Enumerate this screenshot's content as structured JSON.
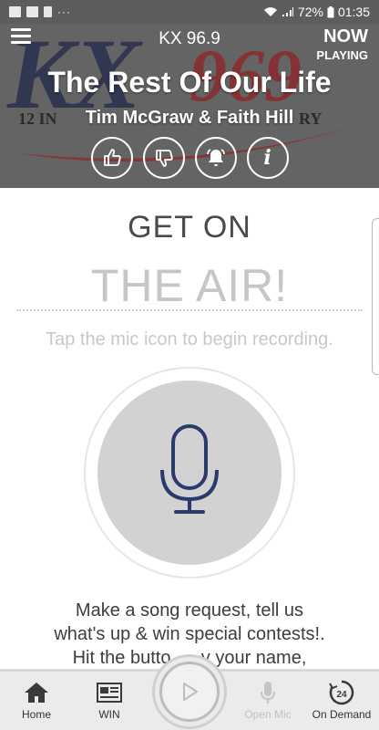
{
  "status_bar": {
    "battery": "72%",
    "time": "01:35",
    "dots": "···"
  },
  "header": {
    "station_name": "KX 96.9",
    "now_label": "NOW",
    "playing_label": "PLAYING",
    "song_title": "The Rest Of Our Life",
    "artist": "Tim McGraw & Faith Hill",
    "logo": {
      "big_text": "KX",
      "number_text": "969",
      "tagline_left": "12 IN",
      "tagline_right": "RY"
    },
    "action_info_label": "i"
  },
  "main": {
    "title_line1": "GET ON",
    "title_line2": "THE AIR!",
    "hint": "Tap the mic icon to begin recording.",
    "description_lines": [
      "Make a song request, tell us",
      "what's up & win special contests!.",
      "Hit the butto      y your name,"
    ]
  },
  "bottom_nav": {
    "items": [
      {
        "label": "Home",
        "icon": "home-icon",
        "enabled": true
      },
      {
        "label": "WIN",
        "icon": "newspaper-icon",
        "enabled": true
      },
      {
        "label": "Open Mic",
        "icon": "microphone-icon",
        "enabled": false
      },
      {
        "label": "On Demand",
        "icon": "on-demand-24-icon",
        "enabled": true
      }
    ],
    "on_demand_badge": "24"
  },
  "colors": {
    "header_bg": "#646464",
    "mic_blue": "#2a3a6b",
    "logo_red": "#b11e25",
    "logo_navy": "#1a2a5c"
  }
}
